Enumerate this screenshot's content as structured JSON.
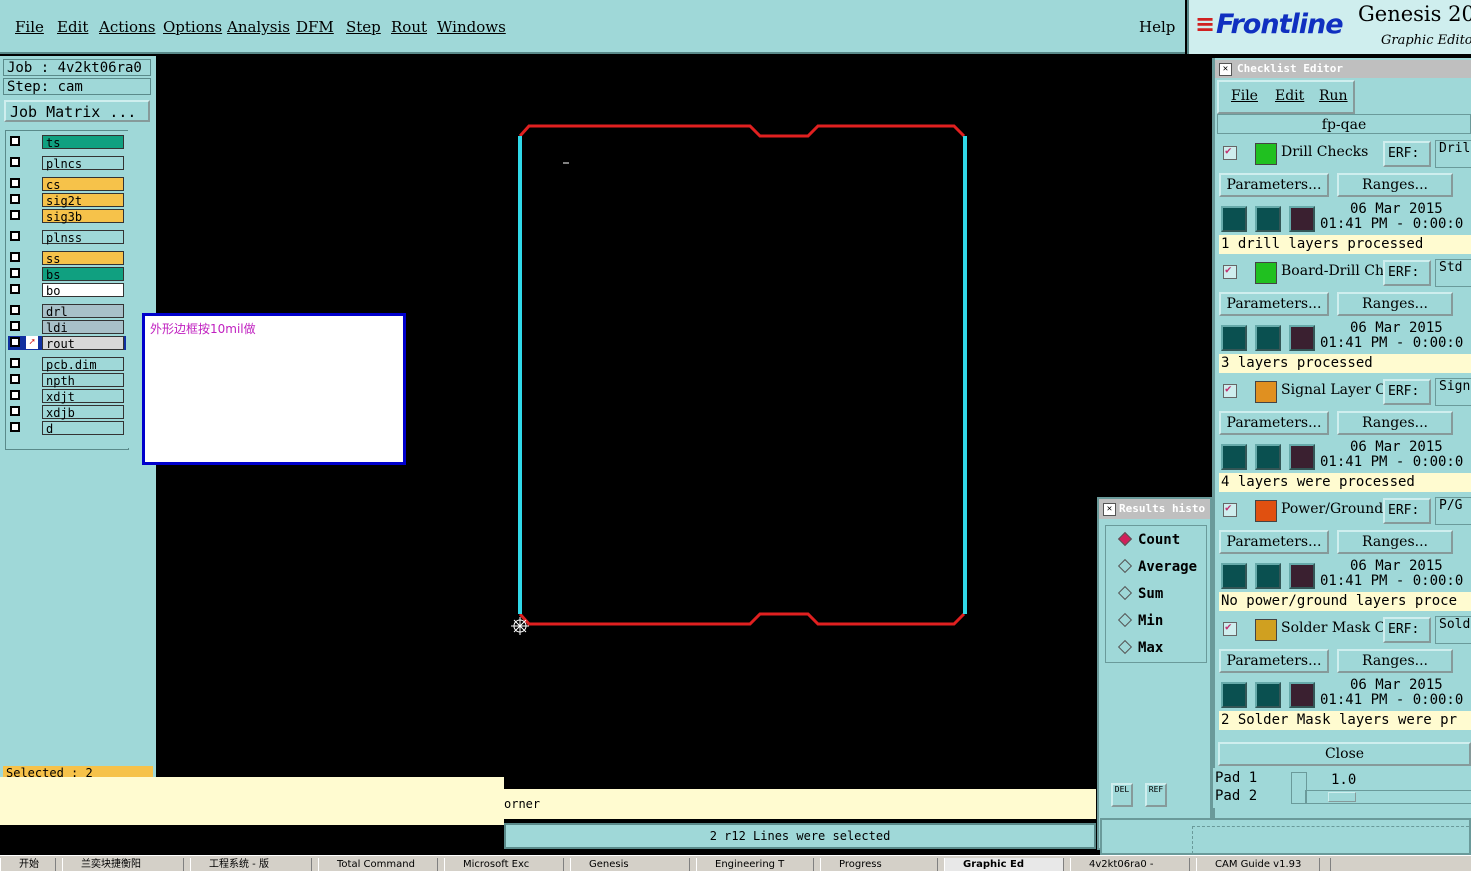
{
  "menu": {
    "items": [
      "File",
      "Edit",
      "Actions",
      "Options",
      "Analysis",
      "DFM",
      "Step",
      "Rout",
      "Windows"
    ],
    "help": "Help"
  },
  "logo": {
    "brand": "Frontline",
    "product": "Genesis 20",
    "subtitle": "Graphic Editor"
  },
  "job": {
    "job_label": "Job : 4v2kt06ra0",
    "step_label": "Step: cam",
    "matrix_button": "Job Matrix ..."
  },
  "layers": [
    {
      "name": "ts",
      "color": "#10a080"
    },
    {
      "name": "plncs",
      "color": "#9fd8d8"
    },
    {
      "name": "cs",
      "color": "#f6c24a"
    },
    {
      "name": "sig2t",
      "color": "#f6c24a"
    },
    {
      "name": "sig3b",
      "color": "#f6c24a"
    },
    {
      "name": "plnss",
      "color": "#9fd8d8"
    },
    {
      "name": "ss",
      "color": "#f6c24a"
    },
    {
      "name": "bs",
      "color": "#10a080"
    },
    {
      "name": "bo",
      "color": "#ffffff"
    },
    {
      "name": "drl",
      "color": "#a8c0c8"
    },
    {
      "name": "ldi",
      "color": "#a8c0c8"
    },
    {
      "name": "rout",
      "color": "#d8d8d8"
    },
    {
      "name": "pcb.dim",
      "color": "#9fd8d8"
    },
    {
      "name": "npth",
      "color": "#9fd8d8"
    },
    {
      "name": "xdjt",
      "color": "#9fd8d8"
    },
    {
      "name": "xdjb",
      "color": "#9fd8d8"
    },
    {
      "name": "d",
      "color": "#9fd8d8"
    }
  ],
  "selected_label": "Selected : 2",
  "note_text": "外形边框按10mil做",
  "status": {
    "line1": "orner",
    "line2": "2 r12 Lines were selected"
  },
  "results": {
    "title": "Results histo",
    "options": [
      "Count",
      "Average",
      "Sum",
      "Min",
      "Max"
    ],
    "selected": "Count",
    "del_label": "DEL",
    "ref_label": "REF"
  },
  "pad_panel": {
    "pad1": "Pad 1",
    "pad2": "Pad 2",
    "value": "1.0"
  },
  "checklist": {
    "title": "Checklist Editor",
    "menu": [
      "File",
      "Edit",
      "Run"
    ],
    "name": "fp-qae",
    "erf_label": "ERF:",
    "params_label": "Parameters...",
    "ranges_label": "Ranges...",
    "close_label": "Close",
    "sections": [
      {
        "name": "Drill Checks",
        "erf": "Dril",
        "date": "06 Mar 2015",
        "time": "01:41 PM - 0:00:0",
        "msg": "1 drill layers processed",
        "icon_color": "#20c020"
      },
      {
        "name": "Board-Drill Che",
        "erf": "Std",
        "date": "06 Mar 2015",
        "time": "01:41 PM - 0:00:0",
        "msg": "3 layers processed",
        "icon_color": "#20c020"
      },
      {
        "name": "Signal Layer Ch",
        "erf": "Sign",
        "date": "06 Mar 2015",
        "time": "01:41 PM - 0:00:0",
        "msg": "4 layers were processed",
        "icon_color": "#e09020"
      },
      {
        "name": "Power/Ground C",
        "erf": "P/G",
        "date": "06 Mar 2015",
        "time": "01:41 PM - 0:00:0",
        "msg": "No power/ground layers proce",
        "icon_color": "#e05010"
      },
      {
        "name": "Solder Mask Ch",
        "erf": "Sold",
        "date": "06 Mar 2015",
        "time": "01:41 PM - 0:00:0",
        "msg": "2 Solder Mask layers were pr",
        "icon_color": "#d0a020"
      }
    ]
  },
  "taskbar": [
    "开始",
    "兰奕块捷衡阳",
    "工程系统 - 版",
    "Total Command",
    "Microsoft Exc",
    "Genesis",
    "Engineering T",
    "Progress",
    "Graphic Ed",
    "4v2kt06ra0 -",
    "CAM Guide v1.93"
  ]
}
